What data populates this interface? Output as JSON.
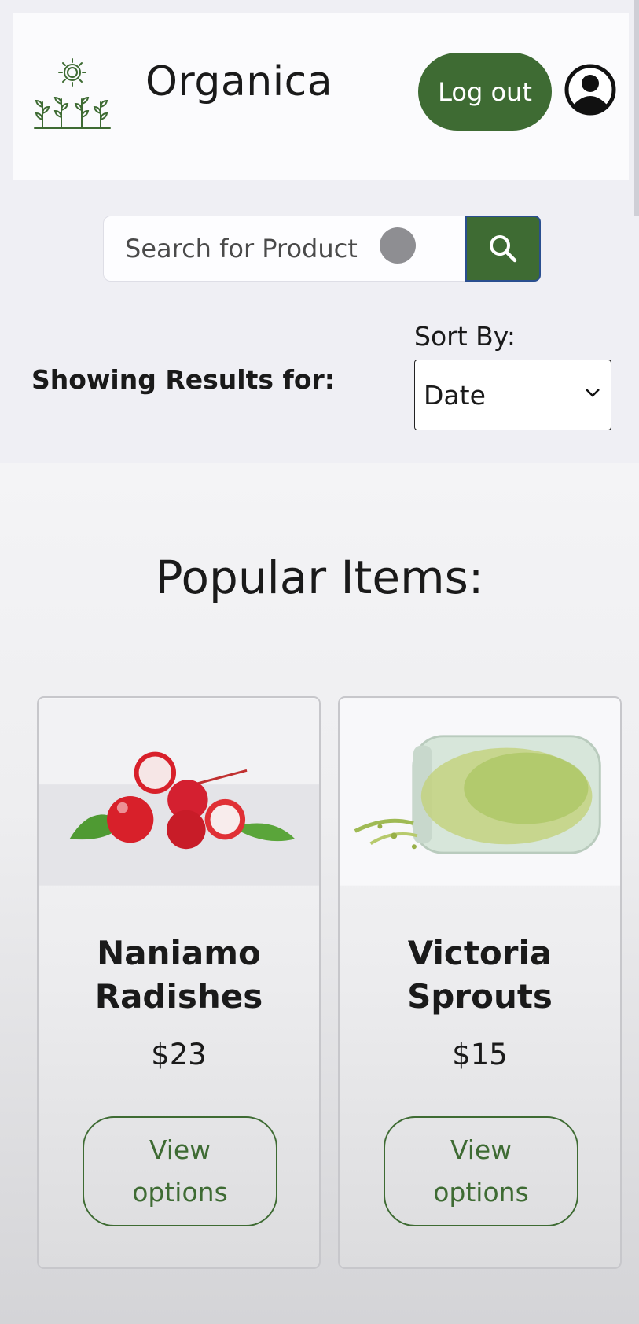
{
  "header": {
    "app_title": "Organica",
    "logo_icon": "sprout-sun-icon",
    "logout_label": "Log out",
    "profile_icon": "user-circle-icon"
  },
  "search": {
    "placeholder": "Search for Product",
    "button_icon": "search-icon"
  },
  "results": {
    "label": "Showing Results for:"
  },
  "sort": {
    "label": "Sort By:",
    "selected": "Date"
  },
  "popular": {
    "title": "Popular Items:",
    "items": [
      {
        "name_line1": "Naniamo",
        "name_line2": "Radishes",
        "price": "$23",
        "button_label": "View options",
        "image": "radishes-photo"
      },
      {
        "name_line1": "Victoria",
        "name_line2": "Sprouts",
        "price": "$15",
        "button_label": "View options",
        "image": "sprouts-jar-photo"
      }
    ]
  },
  "colors": {
    "brand_green": "#3e6b33",
    "background": "#efeff4"
  }
}
